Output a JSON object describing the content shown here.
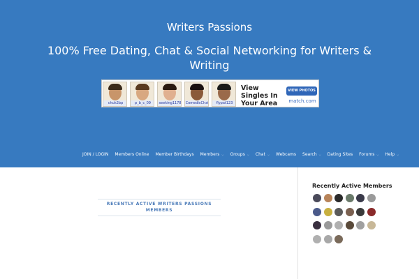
{
  "site": {
    "title": "Writers Passions",
    "tagline": "100% Free Dating, Chat & Social Networking for Writers & Writing"
  },
  "ad": {
    "profiles": [
      {
        "username": "chuk2bp",
        "skin": "#c8956a",
        "hair": "#3a2a1a"
      },
      {
        "username": "p_b_c_09",
        "skin": "#d8a880",
        "hair": "#5a3a20"
      },
      {
        "username": "seeking1178",
        "skin": "#e0b090",
        "hair": "#2a1a10"
      },
      {
        "username": "ComedicChat",
        "skin": "#8a5a3a",
        "hair": "#1a1010"
      },
      {
        "username": "flypat123",
        "skin": "#9a6a4a",
        "hair": "#1a1a1a"
      }
    ],
    "headline": "View Singles In Your Area",
    "button": "VIEW PHOTOS",
    "brand": "match.com"
  },
  "nav": {
    "items": [
      {
        "label": "JOIN / LOGIN",
        "has_dropdown": false
      },
      {
        "label": "Members Online",
        "has_dropdown": false
      },
      {
        "label": "Member Birthdays",
        "has_dropdown": false
      },
      {
        "label": "Members",
        "has_dropdown": true
      },
      {
        "label": "Groups",
        "has_dropdown": true
      },
      {
        "label": "Chat",
        "has_dropdown": true
      },
      {
        "label": "Webcams",
        "has_dropdown": false
      },
      {
        "label": "Search",
        "has_dropdown": true
      },
      {
        "label": "Dating Sites",
        "has_dropdown": false
      },
      {
        "label": "Forums",
        "has_dropdown": true
      },
      {
        "label": "Help",
        "has_dropdown": true
      }
    ]
  },
  "main": {
    "title": "Recently Active Writers Passions Members"
  },
  "sidebar": {
    "title": "Recently Active Members",
    "avatars": [
      {
        "color": "#4a4a5a"
      },
      {
        "color": "#b8845a"
      },
      {
        "color": "#2a2a2a"
      },
      {
        "color": "#6a7a6a"
      },
      {
        "color": "#3a3a4a"
      },
      {
        "color": "#9a9a9a"
      },
      {
        "color": "#4a5a8a"
      },
      {
        "color": "#c8b040"
      },
      {
        "color": "#5a5a5a"
      },
      {
        "color": "#7a6050"
      },
      {
        "color": "#3a3a3a"
      },
      {
        "color": "#8a2a2a"
      },
      {
        "color": "#3a3040"
      },
      {
        "color": "#9a9a9a"
      },
      {
        "color": "#b0b0b0"
      },
      {
        "color": "#5a4a3a"
      },
      {
        "color": "#a0a0a0"
      },
      {
        "color": "#c8b898"
      },
      {
        "color": "#b0b0b0"
      },
      {
        "color": "#a8a8a8"
      },
      {
        "color": "#7a6a5a"
      }
    ]
  },
  "icons": {
    "dropdown": "chevron-down-icon"
  }
}
